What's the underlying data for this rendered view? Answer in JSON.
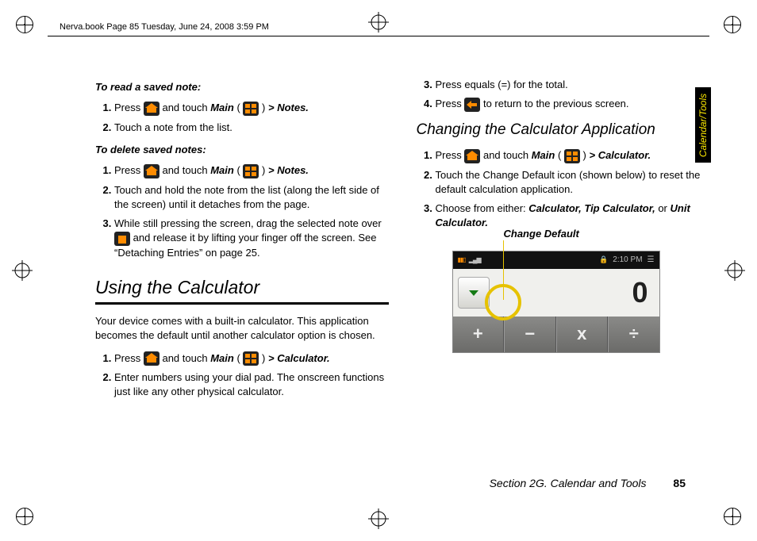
{
  "header": {
    "running": "Nerva.book  Page 85  Tuesday, June 24, 2008  3:59 PM"
  },
  "sideTab": "Calendar/Tools",
  "left": {
    "readHead": "To read a saved note:",
    "read": {
      "s1a": "Press ",
      "s1b": " and touch ",
      "s1c": "Main",
      "s1d": " ( ",
      "s1e": " ) ",
      "s1f": "> ",
      "s1g": "Notes.",
      "s2": "Touch a note from the list."
    },
    "deleteHead": "To delete saved notes:",
    "del": {
      "s1a": "Press ",
      "s1b": " and touch ",
      "s1c": "Main",
      "s1d": " ( ",
      "s1e": " ) ",
      "s1f": "> ",
      "s1g": "Notes.",
      "s2": "Touch and hold the note from the list (along the left side of the screen) until it detaches from the page.",
      "s3a": "While still pressing the screen, drag the selected note over ",
      "s3b": " and release it by lifting your finger off the screen. See “Detaching Entries” on page 25."
    },
    "sectionTitle": "Using the Calculator",
    "intro": "Your device comes with a built-in calculator. This application becomes the default until another calculator option is chosen.",
    "calc": {
      "s1a": "Press ",
      "s1b": " and touch ",
      "s1c": "Main",
      "s1d": " ( ",
      "s1e": " ) ",
      "s1f": "> ",
      "s1g": "Calculator.",
      "s2": "Enter numbers using your dial pad. The onscreen functions just like any other physical calculator."
    }
  },
  "right": {
    "cont": {
      "s3": "Press equals (=) for the total.",
      "s4a": "Press ",
      "s4b": " to return to the previous screen."
    },
    "subsection": "Changing the Calculator Application",
    "change": {
      "s1a": "Press ",
      "s1b": " and touch ",
      "s1c": "Main",
      "s1d": " ( ",
      "s1e": " ) ",
      "s1f": "> ",
      "s1g": "Calculator.",
      "s2": "Touch the Change Default icon (shown below) to reset the default calculation application.",
      "s3a": "Choose from either: ",
      "s3b": "Calculator, Tip Calculator,",
      "s3c": " or ",
      "s3d": "Unit Calculator."
    },
    "callout": "Change Default",
    "device": {
      "time": "2:10 PM",
      "value": "0",
      "ops": {
        "plus": "+",
        "minus": "−",
        "mult": "x",
        "div": "÷"
      }
    }
  },
  "footer": {
    "section": "Section 2G. Calendar and Tools",
    "page": "85"
  }
}
